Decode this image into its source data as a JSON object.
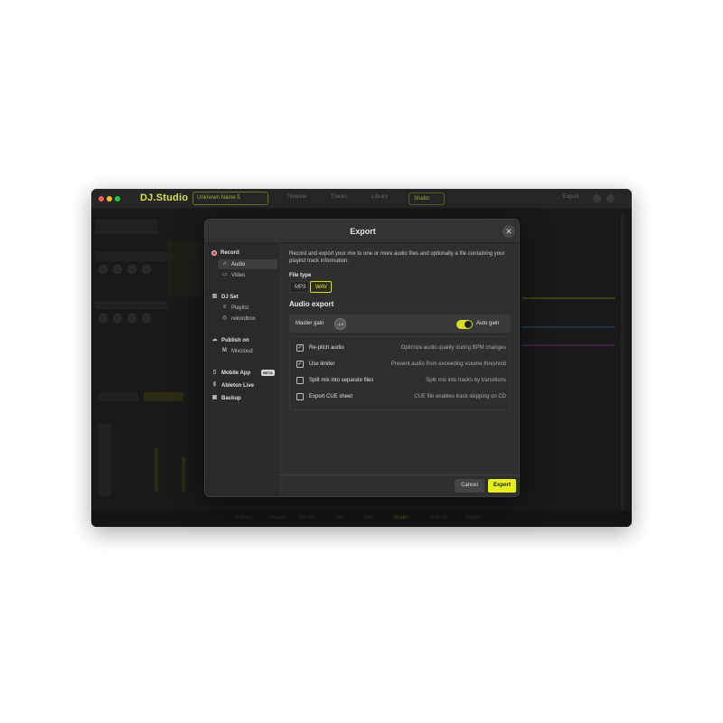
{
  "app": {
    "brand": "DJ.Studio",
    "mix_name": "Unknown Name 5",
    "titlebar_items": [
      "Timeline",
      "Tracks",
      "Library",
      "Studio"
    ],
    "mode_label": "Studio",
    "export_label": "Export",
    "bottom_items": [
      "Library",
      "Recent",
      "Decks",
      "Mix",
      "Hot",
      "Studio",
      "Effects",
      "Loops"
    ]
  },
  "modal": {
    "title": "Export",
    "close_glyph": "✕",
    "sidebar": {
      "record": {
        "label": "Record",
        "items": [
          {
            "label": "Audio",
            "icon": "music-note-icon",
            "active": true
          },
          {
            "label": "Video",
            "icon": "video-camera-icon",
            "active": false
          }
        ]
      },
      "djset": {
        "label": "DJ Set",
        "items": [
          {
            "label": "Playlist",
            "icon": "playlist-icon"
          },
          {
            "label": "rekordbox",
            "icon": "rekordbox-icon"
          }
        ]
      },
      "publish": {
        "label": "Publish on",
        "items": [
          {
            "label": "Mixcloud",
            "icon": "mixcloud-icon"
          }
        ]
      },
      "mobile": {
        "label": "Mobile App",
        "badge": "BETA"
      },
      "ableton": {
        "label": "Ableton Live"
      },
      "backup": {
        "label": "Backup"
      }
    },
    "description": "Record and export your mix to one or more audio files and optionally a file containing your playlist track information.",
    "file_type": {
      "label": "File type",
      "options": [
        "MP3",
        "WAV"
      ],
      "selected": "WAV"
    },
    "audio_export": {
      "title": "Audio export",
      "master_gain_label": "Master gain",
      "master_gain_value": "-1.0",
      "auto_gain_label": "Auto gain",
      "auto_gain_on": true
    },
    "options": [
      {
        "label": "Re-pitch audio",
        "hint": "Optimize audio quality during BPM changes",
        "checked": true
      },
      {
        "label": "Use limiter",
        "hint": "Prevent audio from exceeding volume threshold",
        "checked": true
      },
      {
        "label": "Split mix into separate files",
        "hint": "Split mix into tracks by transitions",
        "checked": false
      },
      {
        "label": "Export CUE sheet",
        "hint": "CUE file enables track skipping on CD",
        "checked": false
      }
    ],
    "buttons": {
      "cancel": "Cancel",
      "export": "Export"
    }
  },
  "colors": {
    "accent": "#e7ef1f",
    "record": "#e04343"
  }
}
